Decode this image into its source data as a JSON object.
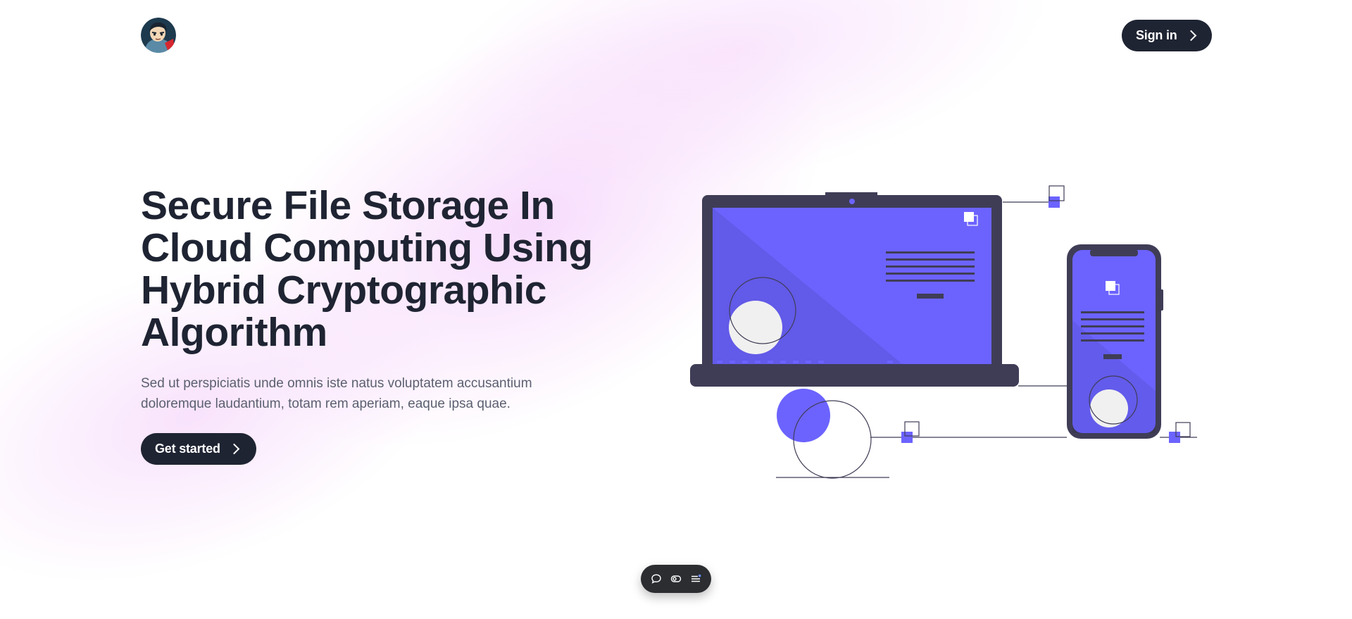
{
  "header": {
    "avatar_label": "Profile avatar",
    "signin_label": "Sign in"
  },
  "hero": {
    "title": "Secure File Storage In Cloud Computing Using Hybrid Cryptographic Algorithm",
    "subtitle": "Sed ut perspiciatis unde omnis iste natus voluptatem accusantium doloremque laudantium, totam rem aperiam, eaque ipsa quae.",
    "cta_label": "Get started"
  },
  "toolbar": {
    "icons": [
      "chat-icon",
      "toggle-icon",
      "menu-icon"
    ]
  },
  "colors": {
    "primary_dark": "#1f2433",
    "accent": "#6c63ff",
    "device_frame": "#3f3d56",
    "muted_text": "#5b6070"
  }
}
